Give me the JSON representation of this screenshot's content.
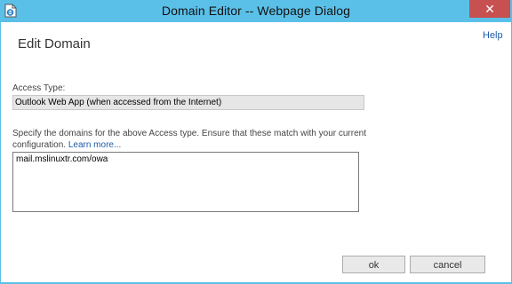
{
  "window": {
    "title": "Domain Editor -- Webpage Dialog",
    "close_glyph": "✕",
    "app_icon": "ie-page-icon"
  },
  "dialog": {
    "help_label": "Help",
    "page_title": "Edit Domain",
    "access_type_label": "Access Type:",
    "access_type_value": "Outlook Web App (when accessed from the Internet)",
    "description_text": "Specify the domains for the above Access type. Ensure that these match with your current configuration. ",
    "learn_more_label": "Learn more...",
    "domains_value": "mail.mslinuxtr.com/owa"
  },
  "buttons": {
    "ok_label": "ok",
    "cancel_label": "cancel"
  },
  "colors": {
    "titlebar": "#5bc0e8",
    "close_button": "#c75050",
    "link": "#1e5aa8"
  }
}
